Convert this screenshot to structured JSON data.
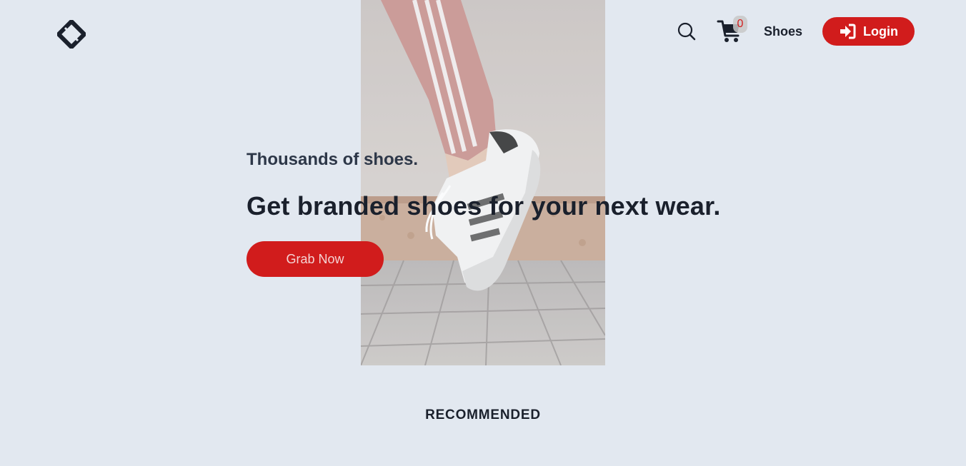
{
  "header": {
    "logo_icon": "diamond-logo-icon",
    "search_icon": "search-icon",
    "cart_icon": "cart-icon",
    "cart_count": "0",
    "nav_link": "Shoes",
    "login_label": "Login",
    "login_icon": "sign-in-icon"
  },
  "hero": {
    "subtitle": "Thousands of shoes.",
    "title": "Get branded shoes for your next wear.",
    "cta_label": "Grab Now",
    "image_alt": "sneaker-photo"
  },
  "sections": {
    "recommended_heading": "RECOMMENDED"
  },
  "colors": {
    "background": "#e2e8f0",
    "accent": "#d11c1c",
    "text": "#1a202c"
  }
}
